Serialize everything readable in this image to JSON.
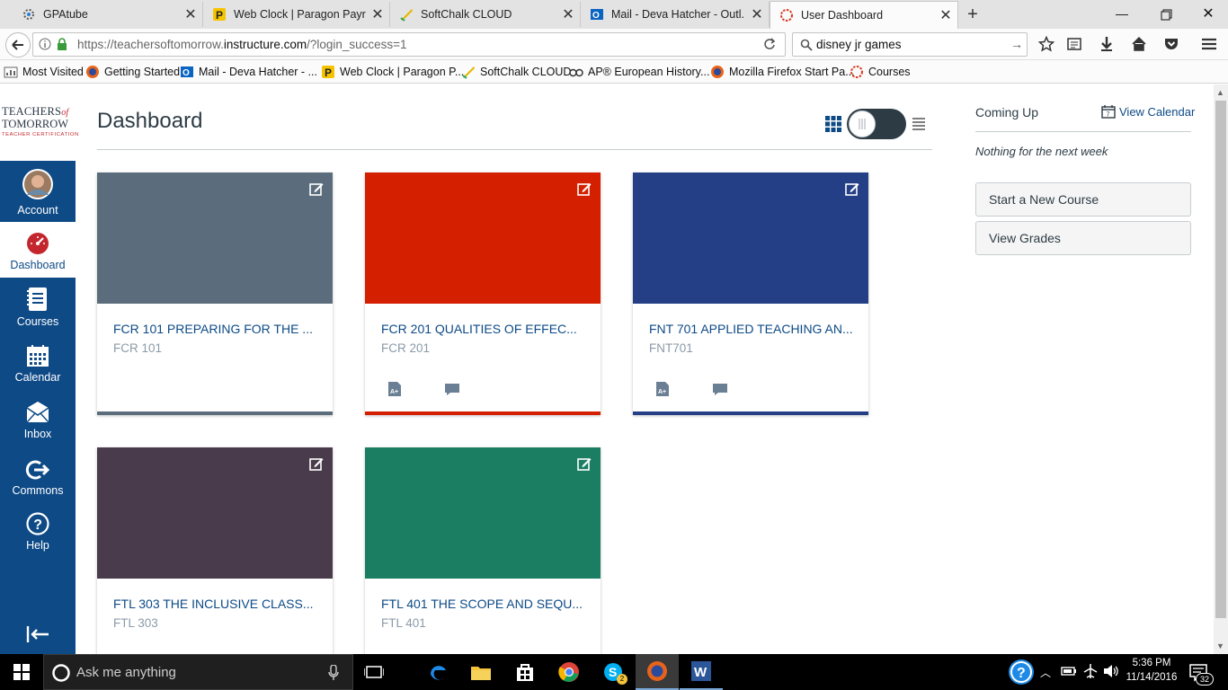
{
  "browser": {
    "tabs": [
      {
        "label": "GPAtube",
        "icon": "gpatube-icon"
      },
      {
        "label": "Web Clock | Paragon Payr...",
        "icon": "paragon-icon"
      },
      {
        "label": "SoftChalk CLOUD",
        "icon": "softchalk-icon"
      },
      {
        "label": "Mail - Deva Hatcher - Outl...",
        "icon": "outlook-icon"
      },
      {
        "label": "User Dashboard",
        "icon": "canvas-icon",
        "active": true
      }
    ],
    "url": "https://teachersoftomorrow.instructure.com/?login_success=1",
    "url_domain_part": "instructure.com",
    "search_value": "disney jr games",
    "bookmarks": [
      {
        "label": "Most Visited",
        "icon": "most-visited-icon"
      },
      {
        "label": "Getting Started",
        "icon": "firefox-icon"
      },
      {
        "label": "Mail - Deva Hatcher - ...",
        "icon": "outlook-icon"
      },
      {
        "label": "Web Clock | Paragon P...",
        "icon": "paragon-icon"
      },
      {
        "label": "SoftChalk CLOUD",
        "icon": "softchalk-icon"
      },
      {
        "label": "AP® European History...",
        "icon": "ap-icon"
      },
      {
        "label": "Mozilla Firefox Start Pa...",
        "icon": "firefox-icon"
      },
      {
        "label": "Courses",
        "icon": "canvas-icon"
      }
    ]
  },
  "logo": {
    "line1": "TEACHERS",
    "of": "of",
    "line2": "TOMORROW",
    "line3": "TEACHER CERTIFICATION"
  },
  "sidebar": {
    "items": [
      {
        "label": "Account",
        "icon": "avatar"
      },
      {
        "label": "Dashboard",
        "icon": "dashboard-icon",
        "active": true
      },
      {
        "label": "Courses",
        "icon": "courses-icon"
      },
      {
        "label": "Calendar",
        "icon": "calendar-icon"
      },
      {
        "label": "Inbox",
        "icon": "inbox-icon"
      },
      {
        "label": "Commons",
        "icon": "commons-icon"
      },
      {
        "label": "Help",
        "icon": "help-icon"
      }
    ]
  },
  "main": {
    "title": "Dashboard"
  },
  "cards": [
    {
      "title": "FCR 101 PREPARING FOR THE ...",
      "code": "FCR 101",
      "color": "#5b6d7c",
      "icons": false
    },
    {
      "title": "FCR 201 QUALITIES OF EFFEC...",
      "code": "FCR 201",
      "color": "#d41f00",
      "icons": true
    },
    {
      "title": "FNT 701 APPLIED TEACHING AN...",
      "code": "FNT701",
      "color": "#243f86",
      "icons": true
    },
    {
      "title": "FTL 303 THE INCLUSIVE CLASS...",
      "code": "FTL 303",
      "color": "#4a3b4c",
      "icons": false
    },
    {
      "title": "FTL 401 THE SCOPE AND SEQU...",
      "code": "FTL 401",
      "color": "#1b7e62",
      "icons": false
    }
  ],
  "right": {
    "coming_up": "Coming Up",
    "view_calendar": "View Calendar",
    "nothing": "Nothing for the next week",
    "start_course": "Start a New Course",
    "view_grades": "View Grades"
  },
  "taskbar": {
    "search_placeholder": "Ask me anything",
    "time": "5:36 PM",
    "date": "11/14/2016",
    "notification_count": "32",
    "skype_badge": "2"
  }
}
